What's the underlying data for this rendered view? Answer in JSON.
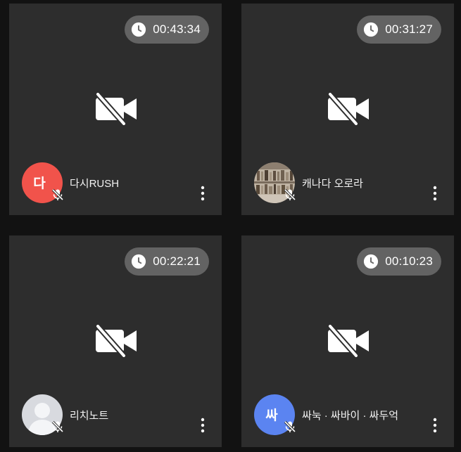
{
  "tiles": [
    {
      "name": "다시RUSH",
      "timer": "00:43:34",
      "avatar": {
        "type": "initial",
        "text": "다",
        "color": "#f1534b"
      }
    },
    {
      "name": "캐나다 오로라",
      "timer": "00:31:27",
      "avatar": {
        "type": "photo",
        "text": ""
      }
    },
    {
      "name": "리치노트",
      "timer": "00:22:21",
      "avatar": {
        "type": "default",
        "text": ""
      }
    },
    {
      "name": "싸눅 · 싸바이 · 싸두억",
      "timer": "00:10:23",
      "avatar": {
        "type": "initial",
        "text": "싸",
        "color": "#5b84f1"
      }
    }
  ],
  "icons": {
    "timer": "clock-icon",
    "video": "video-off-icon",
    "mic": "mic-off-icon",
    "menu": "more-vertical-icon"
  },
  "colors": {
    "tile_background": "#2d2d2d",
    "page_background": "#121212",
    "timer_pill": "#787878"
  }
}
